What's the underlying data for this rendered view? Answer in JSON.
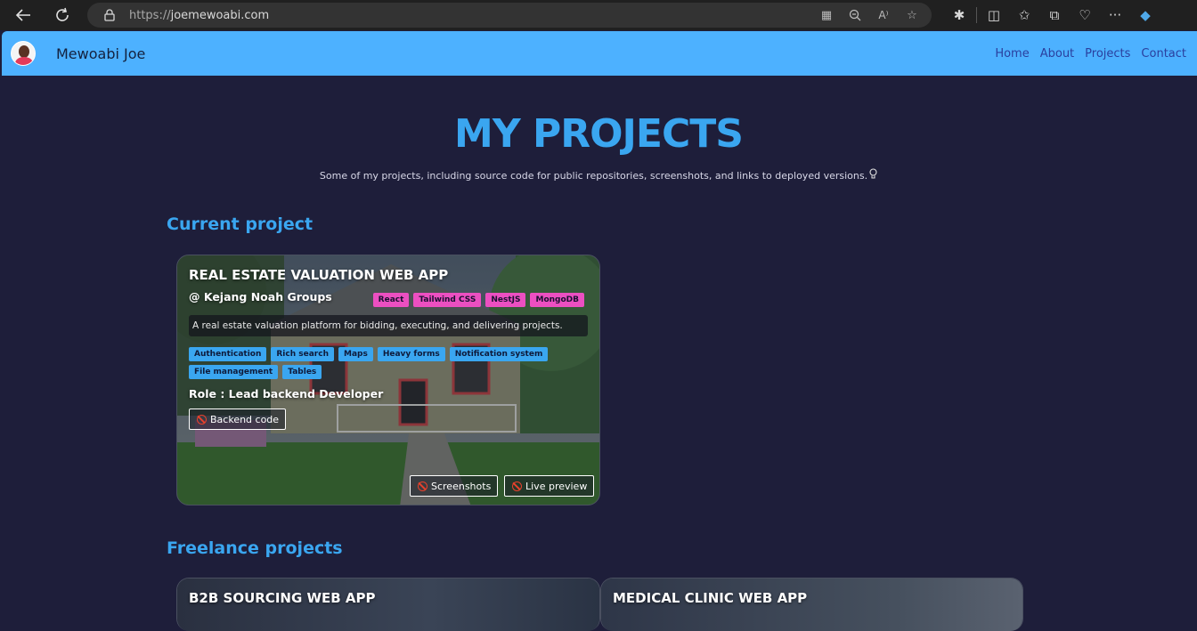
{
  "browser": {
    "url_protocol": "https://",
    "url_host": "joemewoabi.com"
  },
  "nav": {
    "site_name": "Mewoabi Joe",
    "links": [
      "Home",
      "About",
      "Projects",
      "Contact"
    ]
  },
  "page": {
    "title": "MY PROJECTS",
    "subtitle": "Some of my projects, including source code for public repositories, screenshots, and links to deployed versions."
  },
  "current_section": {
    "heading": "Current project",
    "project": {
      "title": "REAL ESTATE VALUATION WEB APP",
      "company": "@ Kejang Noah Groups",
      "tech": [
        "React",
        "Tailwind CSS",
        "NestJS",
        "MongoDB"
      ],
      "description": "A real estate valuation platform for bidding, executing, and delivering projects.",
      "features": [
        "Authentication",
        "Rich search",
        "Maps",
        "Heavy forms",
        "Notification system",
        "File management",
        "Tables"
      ],
      "role": "Role : Lead backend Developer",
      "code_button": "Backend code",
      "screenshots_button": "Screenshots",
      "live_button": "Live preview"
    }
  },
  "freelance_section": {
    "heading": "Freelance projects",
    "projects": [
      {
        "title": "B2B SOURCING WEB APP"
      },
      {
        "title": "MEDICAL CLINIC WEB APP"
      }
    ]
  },
  "colors": {
    "accent": "#3aa6f0",
    "nav_bg": "#4db1ff",
    "page_bg": "#1e1e3a",
    "tech_tag": "#ec4fc1"
  }
}
